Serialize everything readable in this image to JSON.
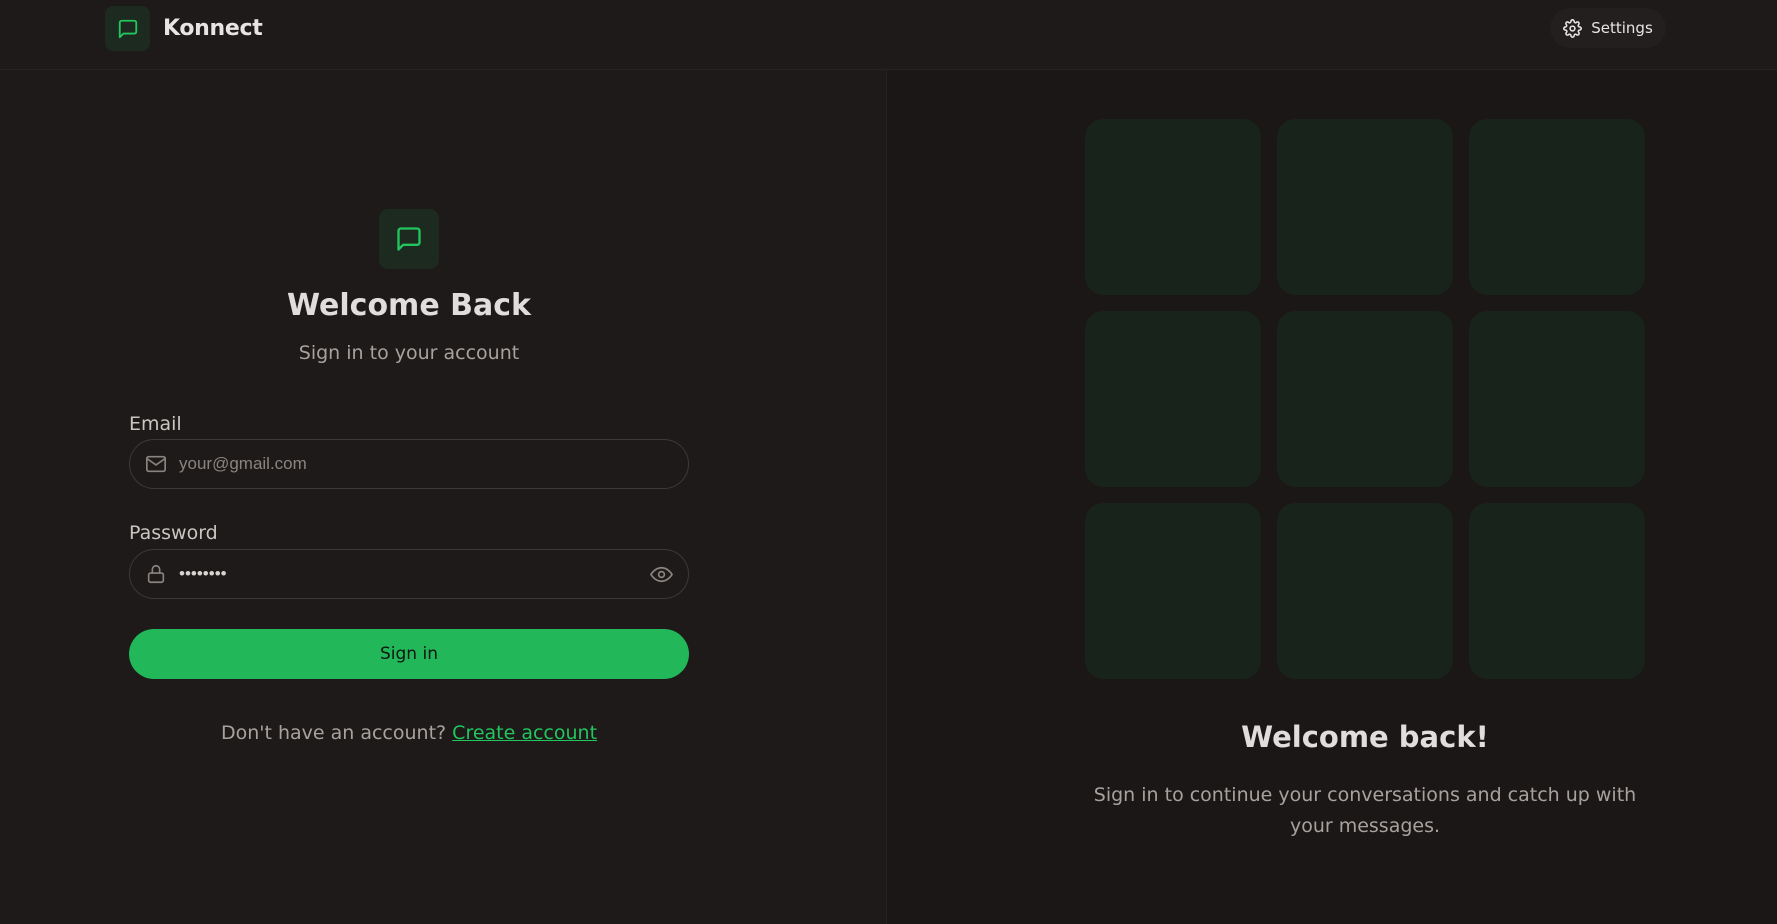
{
  "header": {
    "brand_name": "Konnect",
    "settings_label": "Settings"
  },
  "login": {
    "title": "Welcome Back",
    "subtitle": "Sign in to your account",
    "email_label": "Email",
    "email_placeholder": "your@gmail.com",
    "password_label": "Password",
    "password_value": "••••••••",
    "submit_label": "Sign in",
    "signup_prompt": "Don't have an account?",
    "signup_link": "Create account"
  },
  "promo": {
    "heading": "Welcome back!",
    "text": "Sign in to continue your conversations and catch up with your messages."
  },
  "colors": {
    "accent": "#22b85a",
    "background": "#1d1a19",
    "tile": "#18231b"
  },
  "icons": [
    "message-square-icon",
    "gear-icon",
    "mail-icon",
    "lock-icon",
    "eye-icon"
  ]
}
